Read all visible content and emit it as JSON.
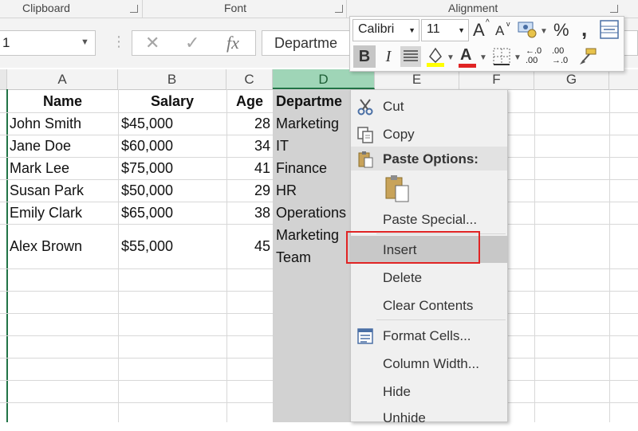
{
  "ribbon": {
    "groups": [
      "Clipboard",
      "Font",
      "Alignment"
    ]
  },
  "formula_bar": {
    "name_box_value": "1",
    "cancel_icon": "✕",
    "enter_icon": "✓",
    "function_icon": "fx",
    "formula_value": "Departme"
  },
  "columns": [
    "A",
    "B",
    "C",
    "D",
    "E",
    "F",
    "G"
  ],
  "selected_column": "D",
  "sheet": {
    "headers": [
      "Name",
      "Salary",
      "Age",
      "Departme"
    ],
    "rows": [
      {
        "name": "John Smith",
        "salary": "$45,000",
        "age": "28",
        "dept": "Marketing"
      },
      {
        "name": "Jane Doe",
        "salary": "$60,000",
        "age": "34",
        "dept": "IT"
      },
      {
        "name": "Mark Lee",
        "salary": "$75,000",
        "age": "41",
        "dept": "Finance"
      },
      {
        "name": "Susan Park",
        "salary": "$50,000",
        "age": "29",
        "dept": "HR"
      },
      {
        "name": "Emily Clark",
        "salary": "$65,000",
        "age": "38",
        "dept": "Operations"
      },
      {
        "name": "Alex Brown",
        "salary": "$55,000",
        "age": "45",
        "dept_line1": "Marketing",
        "dept_line2": "Team"
      }
    ]
  },
  "mini_toolbar": {
    "font_name": "Calibri",
    "font_size": "11",
    "increase_font": "A",
    "decrease_font": "A",
    "percent": "%",
    "comma": ",",
    "bold": "B",
    "italic": "I",
    "font_color_letter": "A",
    "inc_decimal_top": "←.0",
    "inc_decimal_bottom": ".00",
    "dec_decimal_top": ".00",
    "dec_decimal_bottom": "→.0",
    "highlight_color": "#ffff00",
    "font_color": "#e02424"
  },
  "context_menu": {
    "items": {
      "cut": "Cut",
      "copy": "Copy",
      "paste_options": "Paste Options:",
      "paste_special": "Paste Special...",
      "insert": "Insert",
      "delete": "Delete",
      "clear_contents": "Clear Contents",
      "format_cells": "Format Cells...",
      "column_width": "Column Width...",
      "hide": "Hide",
      "unhide": "Unhide"
    },
    "highlighted": "Insert",
    "outline_color": "#e02424"
  },
  "icons": {
    "cut": "scissors-icon",
    "copy": "copy-icon",
    "paste": "clipboard-icon",
    "format_cells": "format-cells-icon"
  }
}
